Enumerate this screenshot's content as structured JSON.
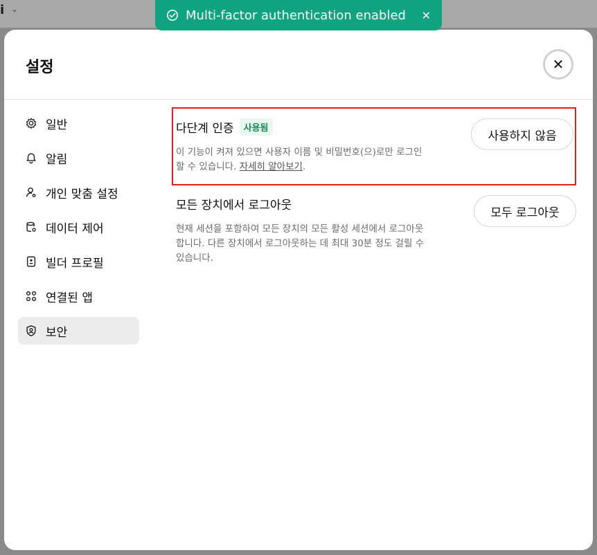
{
  "background": {
    "glyph": "i"
  },
  "toast": {
    "text": "Multi-factor authentication enabled",
    "icon": "check-circle-icon",
    "color": "#10a37f"
  },
  "modal": {
    "title": "설정"
  },
  "sidebar": {
    "items": [
      {
        "label": "일반",
        "icon": "gear-icon"
      },
      {
        "label": "알림",
        "icon": "bell-icon"
      },
      {
        "label": "개인 맞춤 설정",
        "icon": "person-settings-icon"
      },
      {
        "label": "데이터 제어",
        "icon": "database-icon"
      },
      {
        "label": "빌더 프로필",
        "icon": "id-card-icon"
      },
      {
        "label": "연결된 앱",
        "icon": "apps-grid-icon"
      },
      {
        "label": "보안",
        "icon": "shield-user-icon",
        "active": true
      }
    ]
  },
  "security": {
    "mfa": {
      "title": "다단계 인증",
      "badge": "사용됨",
      "description": "이 기능이 켜져 있으면 사용자 이름 및 비밀번호(으)로만 로그인할 수 있습니다.",
      "link": "자세히 알아보기",
      "button": "사용하지 않음"
    },
    "logout": {
      "title": "모든 장치에서 로그아웃",
      "description": "현재 세션을 포함하여 모든 장치의 모든 활성 세션에서 로그아웃합니다. 다른 장치에서 로그아웃하는 데 최대 30분 정도 걸릴 수 있습니다.",
      "button": "모두 로그아웃"
    }
  }
}
